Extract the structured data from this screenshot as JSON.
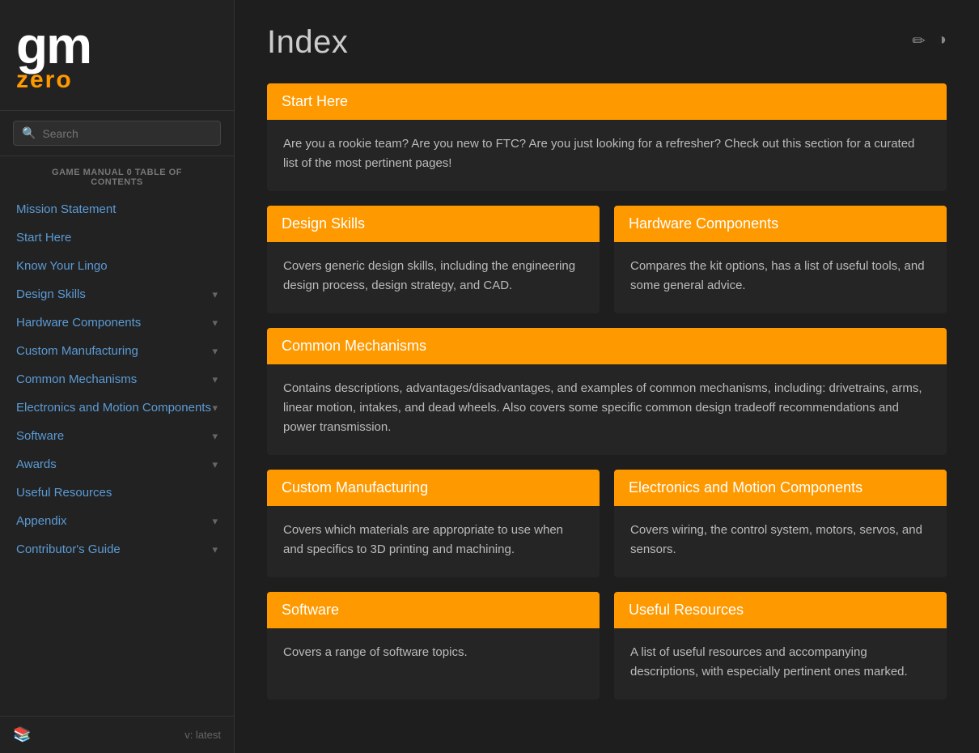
{
  "logo": {
    "gm": "gm",
    "zero": "zero"
  },
  "search": {
    "placeholder": "Search"
  },
  "sidebar": {
    "toc_label": "GAME MANUAL 0 TABLE OF\nCONTENTS",
    "items": [
      {
        "label": "Mission Statement",
        "has_chevron": false
      },
      {
        "label": "Start Here",
        "has_chevron": false
      },
      {
        "label": "Know Your Lingo",
        "has_chevron": false
      },
      {
        "label": "Design Skills",
        "has_chevron": true
      },
      {
        "label": "Hardware Components",
        "has_chevron": true
      },
      {
        "label": "Custom Manufacturing",
        "has_chevron": true
      },
      {
        "label": "Common Mechanisms",
        "has_chevron": true
      },
      {
        "label": "Electronics and Motion Components",
        "has_chevron": true
      },
      {
        "label": "Software",
        "has_chevron": true
      },
      {
        "label": "Awards",
        "has_chevron": true
      },
      {
        "label": "Useful Resources",
        "has_chevron": false
      },
      {
        "label": "Appendix",
        "has_chevron": true
      },
      {
        "label": "Contributor's Guide",
        "has_chevron": true
      }
    ],
    "version": "v: latest"
  },
  "header": {
    "title": "Index",
    "edit_icon": "✏",
    "theme_icon": "◑"
  },
  "cards": {
    "start_here": {
      "header": "Start Here",
      "body": "Are you a rookie team? Are you new to FTC? Are you just looking for a refresher? Check out this section for a curated list of the most pertinent pages!"
    },
    "design_skills": {
      "header": "Design Skills",
      "body": "Covers generic design skills, including the engineering design process, design strategy, and CAD."
    },
    "hardware_components": {
      "header": "Hardware Components",
      "body": "Compares the kit options, has a list of useful tools, and some general advice."
    },
    "common_mechanisms": {
      "header": "Common Mechanisms",
      "body": "Contains descriptions, advantages/disadvantages, and examples of common mechanisms, including: drivetrains, arms, linear motion, intakes, and dead wheels. Also covers some specific common design tradeoff recommendations and power transmission."
    },
    "custom_manufacturing": {
      "header": "Custom Manufacturing",
      "body": "Covers which materials are appropriate to use when and specifics to 3D printing and machining."
    },
    "electronics_motion": {
      "header": "Electronics and Motion Components",
      "body": "Covers wiring, the control system, motors, servos, and sensors."
    },
    "software": {
      "header": "Software",
      "body": "Covers a range of software topics."
    },
    "useful_resources": {
      "header": "Useful Resources",
      "body": "A list of useful resources and accompanying descriptions, with especially pertinent ones marked."
    }
  }
}
